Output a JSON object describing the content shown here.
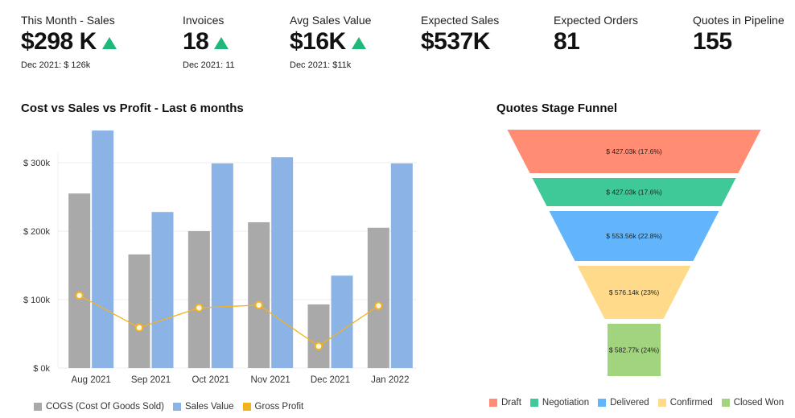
{
  "kpis": [
    {
      "label": "This Month - Sales",
      "value": "$298 K",
      "trend": "up",
      "sub": "Dec 2021: $ 126k"
    },
    {
      "label": "Invoices",
      "value": "18",
      "trend": "up",
      "sub": "Dec 2021: 11"
    },
    {
      "label": "Avg Sales Value",
      "value": "$16K",
      "trend": "up",
      "sub": "Dec 2021: $11k"
    },
    {
      "label": "Expected Sales",
      "value": "$537K",
      "trend": null,
      "sub": ""
    },
    {
      "label": "Expected Orders",
      "value": "81",
      "trend": null,
      "sub": ""
    },
    {
      "label": "Quotes in Pipeline",
      "value": "155",
      "trend": null,
      "sub": ""
    }
  ],
  "colors": {
    "trend_up": "#1fb77a",
    "cogs": "#a9a9a9",
    "sales": "#8cb3e6",
    "profit": "#f2b31f"
  },
  "chart_data": [
    {
      "type": "bar",
      "title": "Cost vs Sales vs Profit - Last 6 months",
      "xlabel": "",
      "ylabel": "",
      "categories": [
        "Aug 2021",
        "Sep 2021",
        "Oct 2021",
        "Nov 2021",
        "Dec 2021",
        "Jan 2022"
      ],
      "yticks": [
        0,
        100,
        200,
        300
      ],
      "ytick_labels": [
        "$ 0k",
        "$ 100k",
        "$ 200k",
        "$ 300k"
      ],
      "ylim": [
        0,
        350
      ],
      "grid": true,
      "legend_position": "bottom-left",
      "series": [
        {
          "name": "COGS (Cost Of Goods Sold)",
          "kind": "bar",
          "color": "#a9a9a9",
          "values": [
            255,
            166,
            200,
            213,
            93,
            205
          ]
        },
        {
          "name": "Sales Value",
          "kind": "bar",
          "color": "#8cb3e6",
          "values": [
            347,
            228,
            299,
            308,
            135,
            299
          ]
        },
        {
          "name": "Gross Profit",
          "kind": "line",
          "color": "#f2b31f",
          "values": [
            106,
            59,
            88,
            92,
            32,
            91
          ]
        }
      ],
      "units": "thousand USD"
    },
    {
      "type": "funnel",
      "title": "Quotes Stage Funnel",
      "legend_position": "bottom",
      "stages": [
        {
          "name": "Draft",
          "value": 427.03,
          "label": "$ 427.03k (17.6%)",
          "percent": 17.6,
          "color": "#ff8c73"
        },
        {
          "name": "Negotiation",
          "value": 427.03,
          "label": "$ 427.03k (17.6%)",
          "percent": 17.6,
          "color": "#40c998"
        },
        {
          "name": "Delivered",
          "value": 553.56,
          "label": "$ 553.56k (22.8%)",
          "percent": 22.8,
          "color": "#63b5fb"
        },
        {
          "name": "Confirmed",
          "value": 576.14,
          "label": "$ 576.14k (23%)",
          "percent": 23,
          "color": "#ffda8a"
        },
        {
          "name": "Closed Won",
          "value": 582.77,
          "label": "$ 582.77k (24%)",
          "percent": 24,
          "color": "#a2d37f"
        }
      ],
      "units": "thousand USD"
    }
  ]
}
